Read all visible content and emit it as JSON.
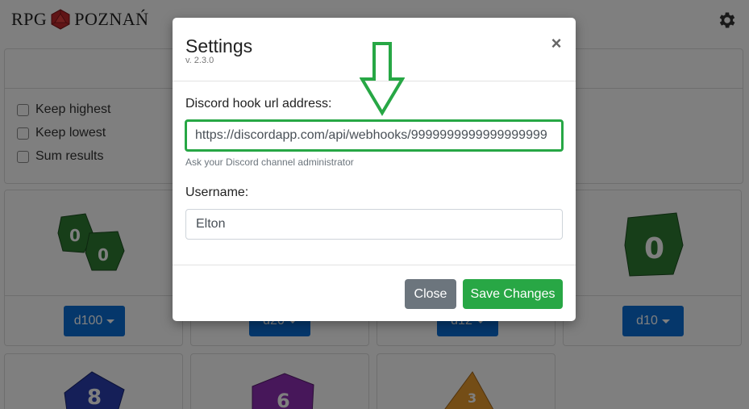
{
  "header": {
    "brand_left": "RPG",
    "brand_right": "POZNAŃ",
    "logo_icon": "d20-logo-icon",
    "settings_icon": "gear-icon"
  },
  "options": [
    {
      "label": "Keep highest"
    },
    {
      "label": "Keep lowest"
    },
    {
      "label": "Sum results"
    }
  ],
  "dice_buttons": [
    {
      "label": "d100"
    },
    {
      "label": "d20"
    },
    {
      "label": "d12"
    },
    {
      "label": "d10"
    }
  ],
  "modal": {
    "title": "Settings",
    "version": "v. 2.3.0",
    "close_symbol": "×",
    "discord_label": "Discord hook url address:",
    "discord_value": "https://discordapp.com/api/webhooks/9999999999999999999",
    "discord_help": "Ask your Discord channel administrator",
    "username_label": "Username:",
    "username_value": "Elton",
    "close_button": "Close",
    "save_button": "Save Changes"
  },
  "colors": {
    "primary": "#0b6fd6",
    "success": "#28a745",
    "secondary": "#6c757d",
    "highlight": "#27a745"
  }
}
